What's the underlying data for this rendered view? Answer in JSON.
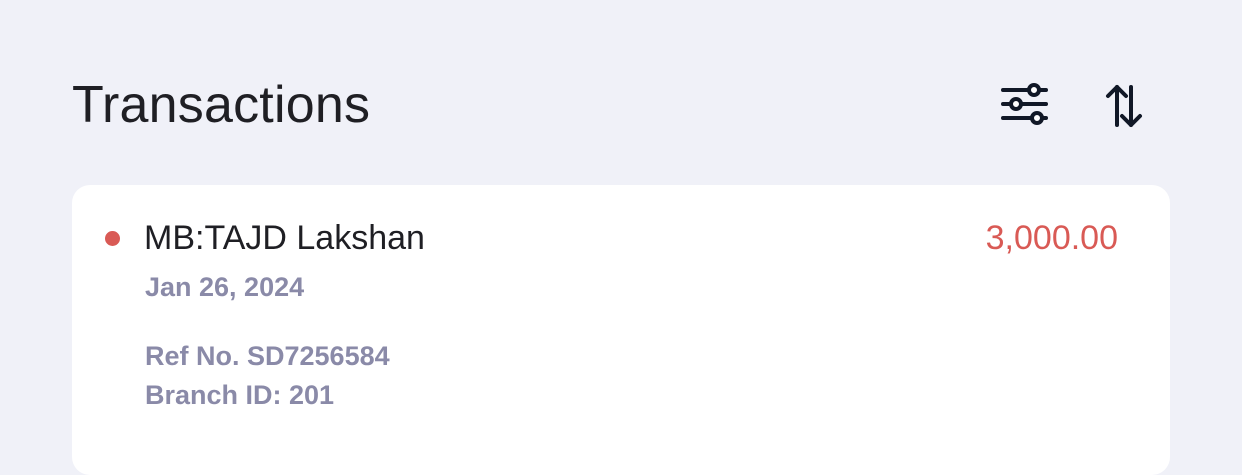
{
  "header": {
    "title": "Transactions",
    "filter_icon": "filter-sliders-icon",
    "sort_icon": "sort-arrows-icon"
  },
  "transactions": [
    {
      "name": "MB:TAJD Lakshan",
      "amount": "3,000.00",
      "date": "Jan 26, 2024",
      "ref": "Ref No. SD7256584",
      "branch": "Branch ID: 201",
      "status_color": "#d95a55"
    }
  ],
  "colors": {
    "background": "#f0f1f8",
    "card": "#ffffff",
    "primary_text": "#1f1f24",
    "secondary_text": "#8a8aa8",
    "debit": "#d95a55",
    "icon": "#111827"
  }
}
